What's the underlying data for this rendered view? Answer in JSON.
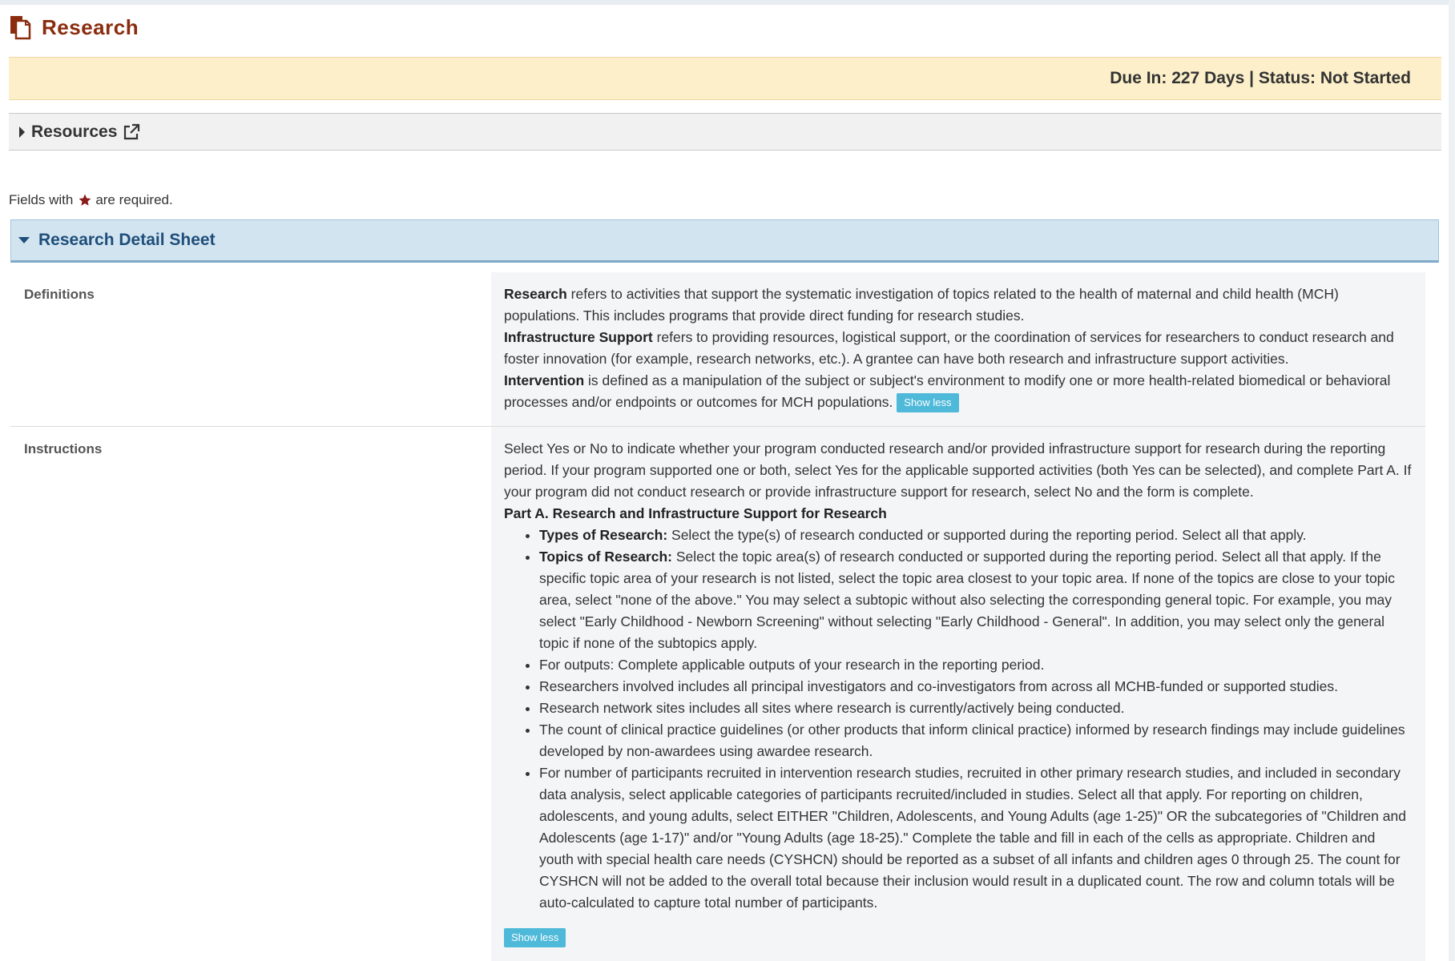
{
  "page": {
    "title": "Research",
    "title_icon": "document-copy-icon"
  },
  "status_bar": {
    "text": "Due In: 227 Days | Status: Not Started"
  },
  "resources": {
    "label": "Resources",
    "icon": "external-link-icon"
  },
  "required_note": {
    "prefix": "Fields with",
    "suffix": "are required.",
    "icon": "star-icon",
    "star_color": "#8b1a1a"
  },
  "section": {
    "title": "Research Detail Sheet"
  },
  "definitions": {
    "label": "Definitions",
    "term1": "Research",
    "text1": " refers to activities that support the systematic investigation of topics related to the health of maternal and child health (MCH) populations. This includes programs that provide direct funding for research studies.",
    "term2": "Infrastructure Support",
    "text2": " refers to providing resources, logistical support, or the coordination of services for researchers to conduct research and foster innovation (for example, research networks, etc.). A grantee can have both research and infrastructure support activities.",
    "term3": "Intervention",
    "text3": " is defined as a manipulation of the subject or subject's environment to modify one or more health-related biomedical or behavioral processes and/or endpoints or outcomes for MCH populations.",
    "show_less": "Show less"
  },
  "instructions": {
    "label": "Instructions",
    "intro": "Select Yes or No to indicate whether your program conducted research and/or provided infrastructure support for research during the reporting period. If your program supported one or both, select Yes for the applicable supported activities (both Yes can be selected), and complete Part A. If your program did not conduct research or provide infrastructure support for research, select No and the form is complete.",
    "part_a_title": "Part A. Research and Infrastructure Support for Research",
    "bullets": [
      {
        "bold": "Types of Research:",
        "text": " Select the type(s) of research conducted or supported during the reporting period. Select all that apply."
      },
      {
        "bold": "Topics of Research:",
        "text": " Select the topic area(s) of research conducted or supported during the reporting period. Select all that apply. If the specific topic area of your research is not listed, select the topic area closest to your topic area. If none of the topics are close to your topic area, select \"none of the above.\" You may select a subtopic without also selecting the corresponding general topic. For example, you may select \"Early Childhood - Newborn Screening\" without selecting \"Early Childhood - General\". In addition, you may select only the general topic if none of the subtopics apply."
      },
      {
        "bold": "",
        "text": "For outputs: Complete applicable outputs of your research in the reporting period."
      },
      {
        "bold": "",
        "text": "Researchers involved includes all principal investigators and co-investigators from across all MCHB-funded or supported studies."
      },
      {
        "bold": "",
        "text": "Research network sites includes all sites where research is currently/actively being conducted."
      },
      {
        "bold": "",
        "text": "The count of clinical practice guidelines (or other products that inform clinical practice) informed by research findings may include guidelines developed by non-awardees using awardee research."
      },
      {
        "bold": "",
        "text": "For number of participants recruited in intervention research studies, recruited in other primary research studies, and included in secondary data analysis, select applicable categories of participants recruited/included in studies. Select all that apply. For reporting on children, adolescents, and young adults, select EITHER \"Children, Adolescents, and Young Adults (age 1-25)\" OR the subcategories of \"Children and Adolescents (age 1-17)\" and/or \"Young Adults (age 18-25).\" Complete the table and fill in each of the cells as appropriate. Children and youth with special health care needs (CYSHCN) should be reported as a subset of all infants and children ages 0 through 25. The count for CYSHCN will not be added to the overall total because their inclusion would result in a duplicated count. The row and column totals will be auto-calculated to capture total number of participants."
      }
    ],
    "show_less": "Show less"
  }
}
